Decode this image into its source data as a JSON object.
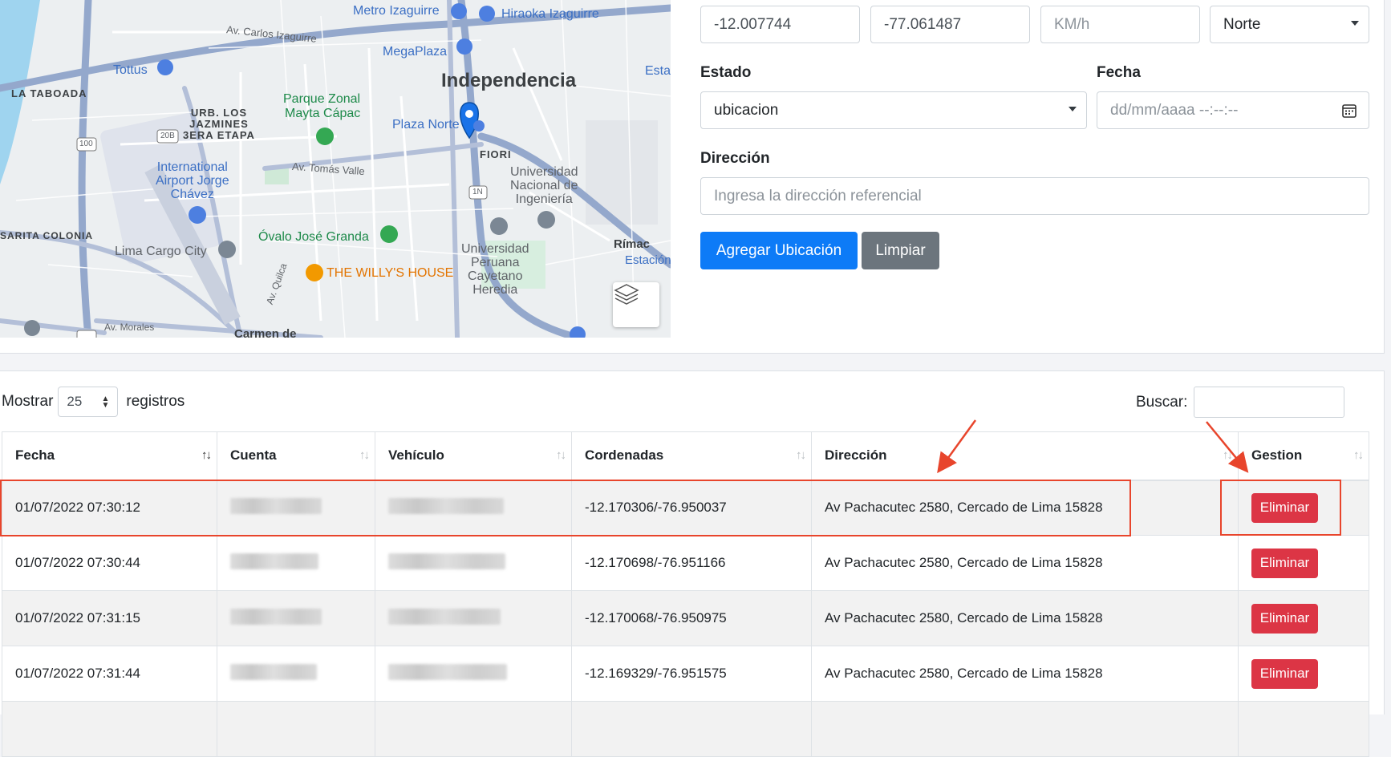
{
  "map": {
    "labels": {
      "metro_izaguirre": "Metro Izaguirre",
      "hiraoka": "Hiraoka Izaguirre",
      "carlos_izaguirre": "Av. Carlos Izaguirre",
      "tottus": "Tottus",
      "la_taboada": "LA TABOADA",
      "megaplaza": "MegaPlaza",
      "independencia": "Independencia",
      "esta": "Esta",
      "parque_zonal": "Parque Zonal",
      "mayta_capac": "Mayta Cápac",
      "urb_los_jazmines": "URB. LOS\nJAZMINES\n3ERA ETAPA",
      "plaza_norte": "Plaza Norte",
      "fiori": "FIORI",
      "tomas_valle": "Av. Tomás Valle",
      "universidad_nacional": "Universidad\nNacional de\nIngeniería",
      "airport": "International\nAirport Jorge\nChávez",
      "sarita_colonia": "SARITA COLONIA",
      "ovalo": "Óvalo José Granda",
      "rimac": "Rímac",
      "estacion": "Estación",
      "lima_cargo": "Lima Cargo City",
      "willys": "THE WILLY'S HOUSE",
      "cayetano": "Universidad\nPeruana\nCayetano\nHeredia",
      "av_quilca": "Av. Quilca",
      "carmen": "Carmen de",
      "av_morales": "Av. Morales",
      "route_100": "100",
      "route_20b": "20B",
      "route_1n": "1N"
    }
  },
  "form": {
    "latitude": "-12.007744",
    "longitude": "-77.061487",
    "speed_placeholder": "KM/h",
    "direction": "Norte",
    "estado_label": "Estado",
    "estado_value": "ubicacion",
    "fecha_label": "Fecha",
    "fecha_placeholder": "dd/mm/aaaa --:--:--",
    "direccion_label": "Dirección",
    "direccion_placeholder": "Ingresa la dirección referencial",
    "add_button": "Agregar Ubicación",
    "clear_button": "Limpiar"
  },
  "table_controls": {
    "show_label": "Mostrar",
    "page_size": "25",
    "records_label": "registros",
    "search_label": "Buscar:"
  },
  "table": {
    "columns": [
      "Fecha",
      "Cuenta",
      "Vehículo",
      "Cordenadas",
      "Dirección",
      "Gestion"
    ],
    "rows": [
      {
        "fecha": "01/07/2022 07:30:12",
        "coords": "-12.170306/-76.950037",
        "direccion": "Av Pachacutec 2580, Cercado de Lima 15828",
        "action": "Eliminar"
      },
      {
        "fecha": "01/07/2022 07:30:44",
        "coords": "-12.170698/-76.951166",
        "direccion": "Av Pachacutec 2580, Cercado de Lima 15828",
        "action": "Eliminar"
      },
      {
        "fecha": "01/07/2022 07:31:15",
        "coords": "-12.170068/-76.950975",
        "direccion": "Av Pachacutec 2580, Cercado de Lima 15828",
        "action": "Eliminar"
      },
      {
        "fecha": "01/07/2022 07:31:44",
        "coords": "-12.169329/-76.951575",
        "direccion": "Av Pachacutec 2580, Cercado de Lima 15828",
        "action": "Eliminar"
      }
    ]
  },
  "colors": {
    "primary": "#0d7bf7",
    "secondary": "#6c757d",
    "danger": "#dc3545",
    "annotation": "#e8452c"
  }
}
